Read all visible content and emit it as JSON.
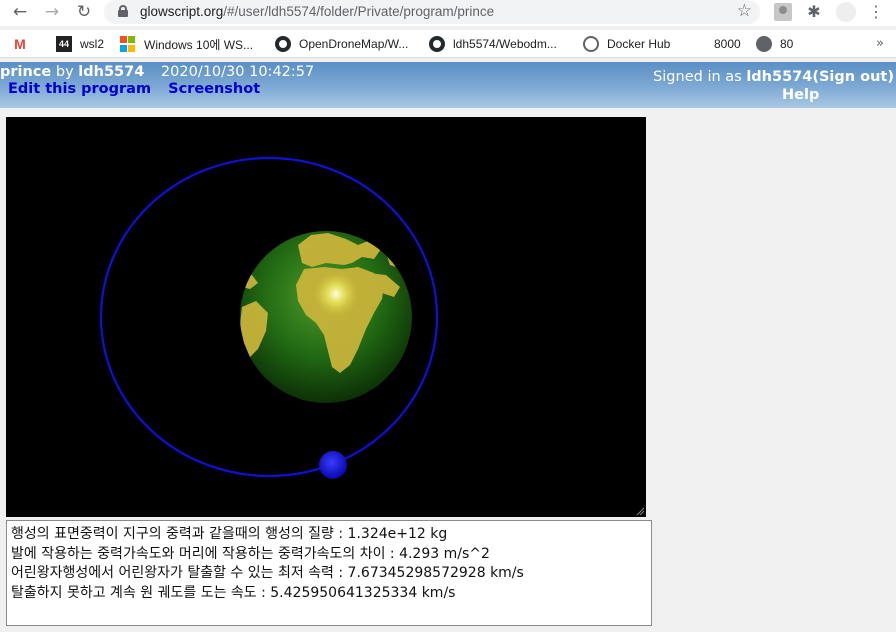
{
  "browser": {
    "url_host": "glowscript.org",
    "url_path": "/#/user/ldh5574/folder/Private/program/prince",
    "bookmarks": [
      {
        "label": ""
      },
      {
        "label": "wsl2"
      },
      {
        "label": "Windows 10에 WS..."
      },
      {
        "label": "OpenDroneMap/W..."
      },
      {
        "label": "ldh5574/Webodm..."
      },
      {
        "label": "Docker Hub"
      },
      {
        "label": "8000"
      },
      {
        "label": "80"
      }
    ],
    "more_label": "»"
  },
  "header": {
    "program_name": "prince",
    "by_label": "by",
    "owner": "ldh5574",
    "datetime": "2020/10/30 10:42:57",
    "edit_label": "Edit this program",
    "screenshot_label": "Screenshot",
    "signed_in_prefix": "Signed in as",
    "signed_in_user": "ldh5574",
    "sign_out_label": "(Sign out)",
    "help_label": "Help"
  },
  "output": {
    "lines": [
      "행성의 표면중력이 지구의 중력과 같을때의 행성의 질량 : 1.324e+12 kg",
      "발에 작용하는 중력가속도와 머리에 작용하는 중력가속도의 차이 : 4.293 m/s^2",
      "어린왕자행성에서 어린왕자가 탈출할 수 있는 최저 속력 : 7.67345298572928 km/s",
      "탈출하지 못하고 계속 원 궤도를 도는 속도 : 5.425950641325334 km/s"
    ]
  },
  "colors": {
    "orbit": "#1010d8",
    "planet": "#1a4d0f",
    "moon": "#1a1aff",
    "header_link": "#0000cc"
  }
}
